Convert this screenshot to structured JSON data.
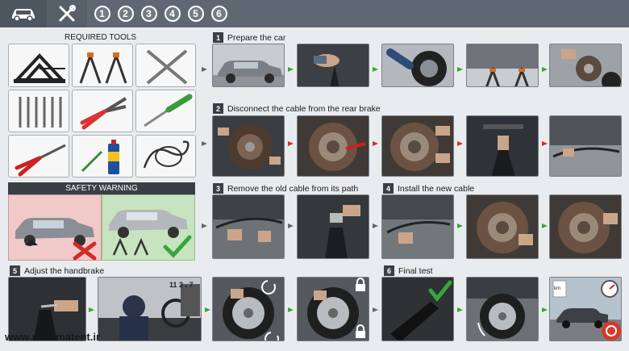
{
  "header": {
    "car_icon": "car-icon",
    "tools_icon": "wrench-screwdriver-icon",
    "steps": [
      "1",
      "2",
      "3",
      "4",
      "5",
      "6"
    ]
  },
  "tools": {
    "title": "REQUIRED TOOLS"
  },
  "safety": {
    "title": "SAFETY WARNING"
  },
  "sections": {
    "s1": {
      "num": "1",
      "title": "Prepare the car"
    },
    "s2": {
      "num": "2",
      "title": "Disconnect the cable from the rear brake"
    },
    "s3": {
      "num": "3",
      "title": "Remove the old cable from its path"
    },
    "s4": {
      "num": "4",
      "title": "Install the new cable"
    },
    "s5": {
      "num": "5",
      "title": "Adjust the handbrake"
    },
    "s6": {
      "num": "6",
      "title": "Final test"
    }
  },
  "dashboard_digits": "11 2 . 7",
  "speed_sign": "km",
  "watermark": "www.maximatent.ir",
  "colors": {
    "accent_green": "#3aa53a",
    "accent_red": "#d42a2a",
    "topbar": "#5f6872"
  }
}
